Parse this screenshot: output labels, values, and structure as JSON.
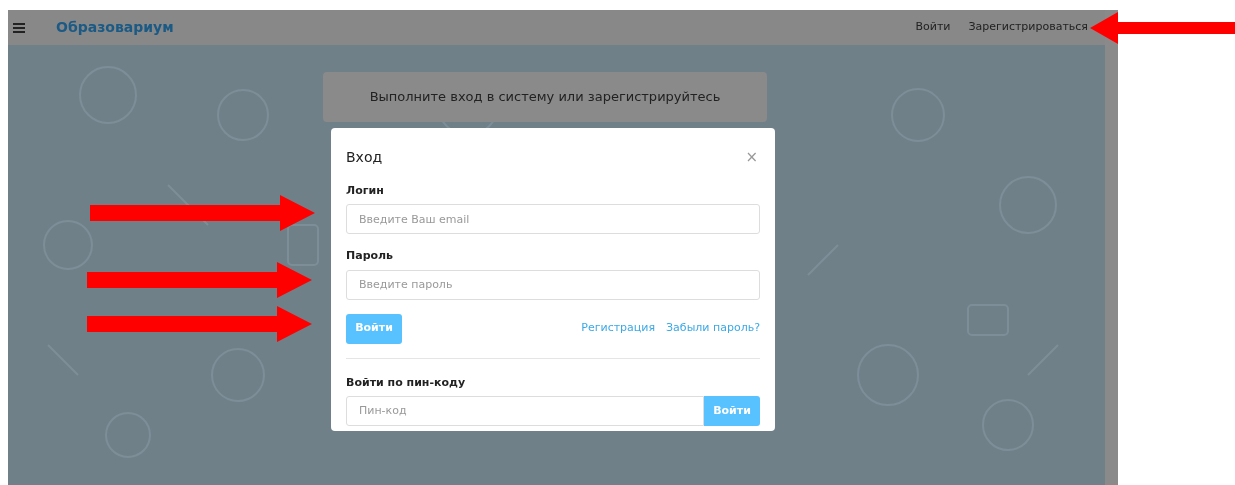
{
  "navbar": {
    "brand": "Образовариум",
    "links": [
      "Войти",
      "Зарегистрироваться"
    ]
  },
  "banner": {
    "text": "Выполните вход в систему или зарегистрируйтесь"
  },
  "modal": {
    "title": "Вход",
    "close": "×",
    "fields": [
      {
        "label": "Логин",
        "placeholder": "Введите Ваш email"
      },
      {
        "label": "Пароль",
        "placeholder": "Введите пароль"
      }
    ],
    "submit": "Войти",
    "links": [
      "Регистрация",
      "Забыли пароль?"
    ],
    "pin": {
      "label": "Войти по пин-коду",
      "placeholder": "Пин-код",
      "button": "Войти"
    }
  },
  "arrows": [
    {
      "kind": "left"
    },
    {
      "kind": "right"
    },
    {
      "kind": "right"
    },
    {
      "kind": "right"
    }
  ]
}
